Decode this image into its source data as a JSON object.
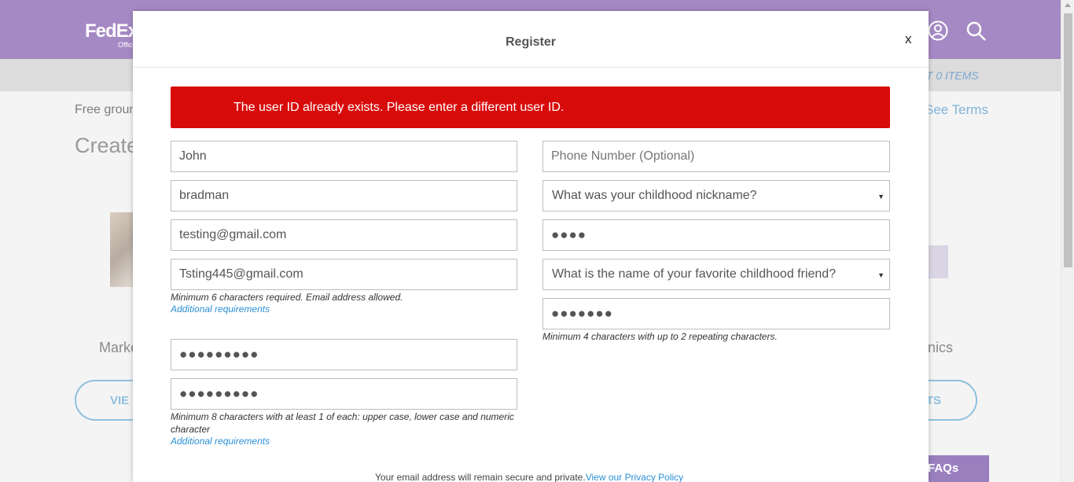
{
  "background": {
    "logo_main": "FedEx",
    "logo_sub": "Office",
    "cart_label": "RT",
    "cart_count": "0 ITEMS",
    "free_text": "Free groun",
    "terms_link": "See Terms",
    "create_heading": "Create",
    "market_text": "Marke",
    "nics_text": "nics",
    "view_button": "VIE",
    "ts_button": "TS",
    "faqs_button": "FAQs"
  },
  "modal": {
    "title": "Register",
    "close_label": "x",
    "error_message": "The user ID already exists. Please enter a different user ID.",
    "left": {
      "first_name": "John",
      "last_name": "bradman",
      "email": "testing@gmail.com",
      "user_id": "Tsting445@gmail.com",
      "user_id_hint": "Minimum 6 characters required. Email address allowed.",
      "user_id_link": "Additional requirements",
      "password_mask": "●●●●●●●●●",
      "confirm_password_mask": "●●●●●●●●●",
      "password_hint": "Minimum 8 characters with at least 1 of each: upper case, lower case and numeric character",
      "password_link": "Additional requirements"
    },
    "right": {
      "phone_placeholder": "Phone Number (Optional)",
      "question1": "What was your childhood nickname?",
      "answer1_mask": "●●●●",
      "question2": "What is the name of your favorite childhood friend?",
      "answer2_mask": "●●●●●●●",
      "answer_hint": "Minimum 4 characters with up to 2 repeating characters."
    },
    "privacy_text": "Your email address will remain secure and private.",
    "privacy_link": "View our Privacy Policy"
  },
  "colors": {
    "header_purple": "#a589c4",
    "error_red": "#d80b0b",
    "link_blue": "#2b8fd6"
  }
}
